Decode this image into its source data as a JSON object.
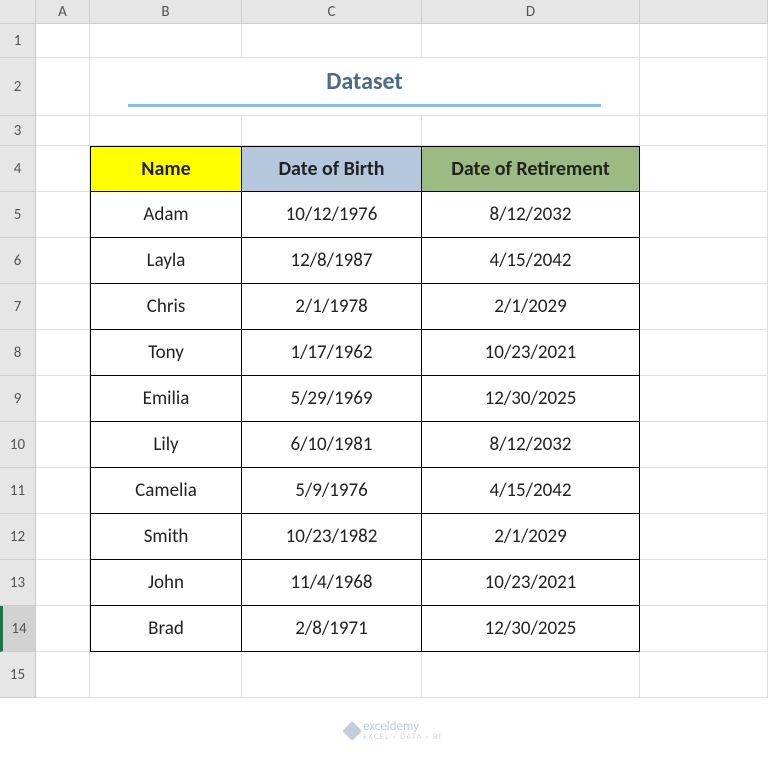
{
  "columns": [
    "",
    "A",
    "B",
    "C",
    "D",
    ""
  ],
  "rows": [
    "1",
    "2",
    "3",
    "4",
    "5",
    "6",
    "7",
    "8",
    "9",
    "10",
    "11",
    "12",
    "13",
    "14",
    "15"
  ],
  "selectedRow": 14,
  "title": "Dataset",
  "headers": {
    "name": "Name",
    "dob": "Date of Birth",
    "ret": "Date of Retirement"
  },
  "data": [
    {
      "name": "Adam",
      "dob": "10/12/1976",
      "ret": "8/12/2032"
    },
    {
      "name": "Layla",
      "dob": "12/8/1987",
      "ret": "4/15/2042"
    },
    {
      "name": "Chris",
      "dob": "2/1/1978",
      "ret": "2/1/2029"
    },
    {
      "name": "Tony",
      "dob": "1/17/1962",
      "ret": "10/23/2021"
    },
    {
      "name": "Emilia",
      "dob": "5/29/1969",
      "ret": "12/30/2025"
    },
    {
      "name": "Lily",
      "dob": "6/10/1981",
      "ret": "8/12/2032"
    },
    {
      "name": "Camelia",
      "dob": "5/9/1976",
      "ret": "4/15/2042"
    },
    {
      "name": "Smith",
      "dob": "10/23/1982",
      "ret": "2/1/2029"
    },
    {
      "name": "John",
      "dob": "11/4/1968",
      "ret": "10/23/2021"
    },
    {
      "name": "Brad",
      "dob": "2/8/1971",
      "ret": "12/30/2025"
    }
  ],
  "watermark": {
    "brand": "exceldemy",
    "tag": "EXCEL · DATA · BI"
  }
}
